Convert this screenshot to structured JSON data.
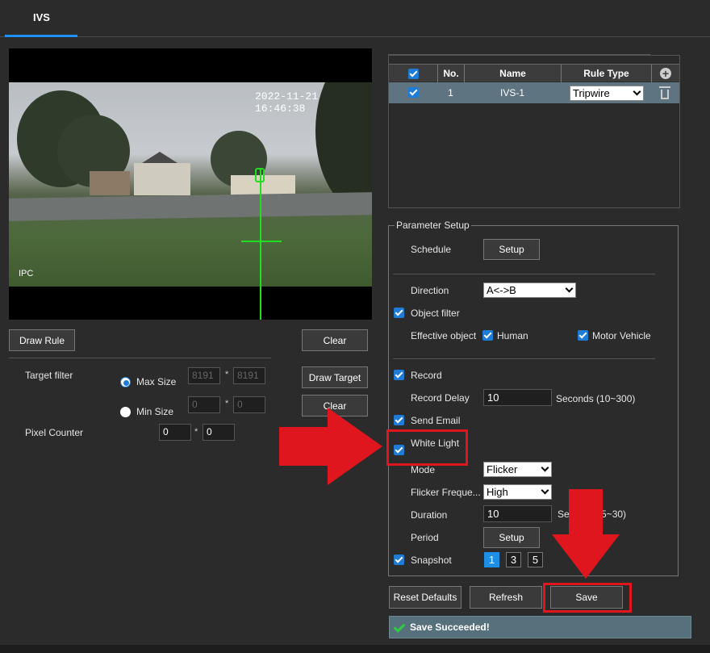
{
  "tab": {
    "label": "IVS"
  },
  "video": {
    "timestamp": "2022-11-21 16:46:38",
    "channel_label": "IPC"
  },
  "left_controls": {
    "draw_rule": "Draw Rule",
    "clear": "Clear",
    "draw_target": "Draw Target",
    "clear2": "Clear",
    "target_filter_label": "Target filter",
    "max_size_label": "Max Size",
    "min_size_label": "Min Size",
    "max_w": "8191",
    "max_h": "8191",
    "min_w": "0",
    "min_h": "0",
    "star": "*",
    "pixel_counter_label": "Pixel Counter",
    "pixel_w": "0",
    "pixel_h": "0"
  },
  "rule_table": {
    "headers": {
      "no": "No.",
      "name": "Name",
      "rule_type": "Rule Type"
    },
    "rows": [
      {
        "no": "1",
        "name": "IVS-1",
        "rule_type": "Tripwire"
      }
    ]
  },
  "params": {
    "legend": "Parameter Setup",
    "schedule_label": "Schedule",
    "setup": "Setup",
    "direction_label": "Direction",
    "direction_value": "A<->B",
    "object_filter_label": "Object filter",
    "effective_object_label": "Effective object",
    "human_label": "Human",
    "motor_vehicle_label": "Motor Vehicle",
    "record_label": "Record",
    "record_delay_label": "Record Delay",
    "record_delay_value": "10",
    "record_delay_unit": "Seconds (10~300)",
    "send_email_label": "Send Email",
    "white_light_label": "White Light",
    "mode_label": "Mode",
    "mode_value": "Flicker",
    "flicker_freq_label": "Flicker Freque...",
    "flicker_freq_value": "High",
    "duration_label": "Duration",
    "duration_value": "10",
    "duration_unit": "Seconds (5~30)",
    "period_label": "Period",
    "period_setup": "Setup",
    "snapshot_label": "Snapshot",
    "snapshot_options": [
      "1",
      "3",
      "5"
    ]
  },
  "actions": {
    "reset": "Reset Defaults",
    "refresh": "Refresh",
    "save": "Save"
  },
  "status": {
    "message": "Save Succeeded!"
  },
  "colors": {
    "accent": "#1e90ff",
    "annotation": "#e0161f",
    "status_bg": "#56707c"
  }
}
